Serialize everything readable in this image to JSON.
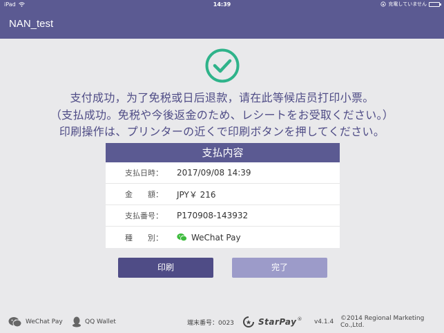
{
  "status_bar": {
    "device": "iPad",
    "time": "14:39",
    "charging_text": "充電していません"
  },
  "navbar": {
    "title": "NAN_test"
  },
  "messages": [
    "支付成功，为了免税或日后退款，请在此等候店员打印小票。",
    "（支払成功。免税や今後返金のため、レシートをお受取ください。）",
    "印刷操作は、プリンターの近くで印刷ボタンを押してください。"
  ],
  "card": {
    "header": "支払内容",
    "rows": [
      {
        "label": "支払日時：",
        "value": "2017/09/08 14:39"
      },
      {
        "label": "金　　額：",
        "value": "JPY￥ 216"
      },
      {
        "label": "支払番号：",
        "value": "P170908-143932"
      },
      {
        "label": "種　　別：",
        "value": "WeChat Pay",
        "icon": "wechat-icon"
      }
    ]
  },
  "buttons": {
    "print": "印刷",
    "done": "完了"
  },
  "footer": {
    "wechat_pay": "WeChat Pay",
    "qq_wallet": "QQ Wallet",
    "terminal": "端末番号：0023",
    "brand": "StarPay",
    "version": "v4.1.4",
    "copyright": "©2014 Regional Marketing Co.,Ltd."
  },
  "colors": {
    "header": "#5b5a92",
    "accent_text": "#4f4c86",
    "success_green": "#2fb38a",
    "wechat_green": "#3dbb3d",
    "done_button": "#9c9bc9"
  }
}
